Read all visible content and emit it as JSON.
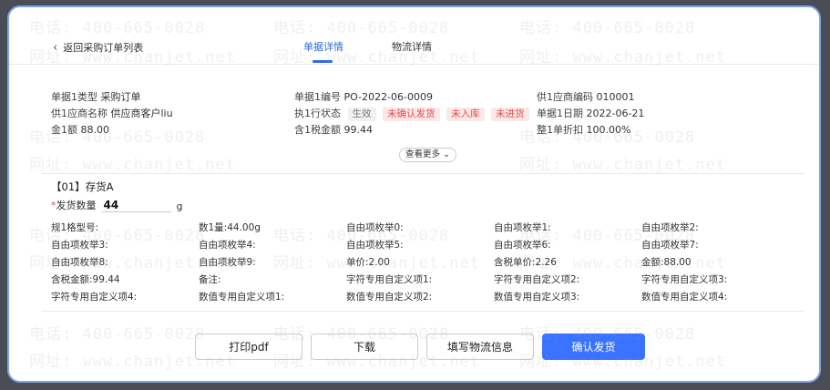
{
  "header": {
    "back_label": "返回采购订单列表",
    "tabs": [
      {
        "label": "单据详情",
        "active": true
      },
      {
        "label": "物流详情",
        "active": false
      }
    ]
  },
  "summary": {
    "doc_type_label": "单据1类型",
    "doc_type_value": "采购订单",
    "doc_no_label": "单据1编号",
    "doc_no_value": "PO-2022-06-0009",
    "supplier_code_label": "供1应商编码",
    "supplier_code_value": "010001",
    "supplier_name_label": "供1应商名称",
    "supplier_name_value": "供应商客户liu",
    "exec_status_label": "执1行状态",
    "status_tags": [
      {
        "text": "生效",
        "style": "gray"
      },
      {
        "text": "未确认发货",
        "style": "red"
      },
      {
        "text": "未入库",
        "style": "red"
      },
      {
        "text": "未进货",
        "style": "red"
      }
    ],
    "doc_date_label": "单据1日期",
    "doc_date_value": "2022-06-21",
    "amount_label": "金1额",
    "amount_value": "88.00",
    "tax_amount_label": "含1税金额",
    "tax_amount_value": "99.44",
    "discount_label": "整1单折扣",
    "discount_value": "100.00%",
    "more_label": "查看更多"
  },
  "item": {
    "title": "【01】存货A",
    "qty_label": "发货数量",
    "qty_value": "44",
    "qty_unit": "g",
    "fields": [
      "规1格型号:",
      "数1量:44.00g",
      "自由项枚举0:",
      "自由项枚举1:",
      "自由项枚举2:",
      "自由项枚举3:",
      "自由项枚举4:",
      "自由项枚举5:",
      "自由项枚举6:",
      "自由项枚举7:",
      "自由项枚举8:",
      "自由项枚举9:",
      "单价:2.00",
      "含税单价:2.26",
      "金额:88.00",
      "含税金额:99.44",
      "备注:",
      "字符专用自定义项1:",
      "字符专用自定义项2:",
      "字符专用自定义项3:",
      "字符专用自定义项4:",
      "数值专用自定义项1:",
      "数值专用自定义项2:",
      "数值专用自定义项3:",
      "数值专用自定义项4:"
    ]
  },
  "footer": {
    "print_label": "打印pdf",
    "download_label": "下载",
    "logistics_label": "填写物流信息",
    "confirm_label": "确认发货"
  },
  "watermark": {
    "phone": "电话: 400-665-0028",
    "site": "网址: www.chanjet.net"
  },
  "colors": {
    "accent": "#2f6bdc",
    "primary_button": "#3a73ff",
    "tag_red": "#e54d4d",
    "frame_border": "#7fa5e6"
  }
}
